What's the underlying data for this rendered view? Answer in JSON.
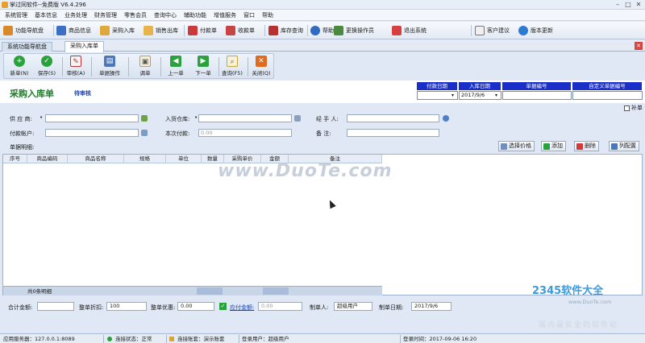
{
  "window": {
    "title": "掌过同软件--免费版 V6.4.296"
  },
  "menu": [
    "系统管理",
    "基本信息",
    "业务处理",
    "财务管理",
    "零售会员",
    "查询中心",
    "辅助功能",
    "增值服务",
    "窗口",
    "帮助"
  ],
  "nav": {
    "items": [
      "功能导航盘",
      "商品信息",
      "采购入库",
      "销售出库",
      "付款单",
      "收款单",
      "库存查询",
      "帮助",
      "更换操作员",
      "退出系统",
      "客户建议",
      "版本更新"
    ]
  },
  "tabs": [
    "系统功能导航盘",
    "采购入库单"
  ],
  "toolbar": {
    "new": "新单(N)",
    "save": "保存(S)",
    "audit": "审核(A)",
    "doc_ops": "单据操作",
    "template": "调单",
    "prev": "上一单",
    "next": "下一单",
    "query": "查询(F5)",
    "close": "关闭(Q)"
  },
  "document": {
    "title": "采购入库单",
    "status": "待审核"
  },
  "header_grid": {
    "columns": [
      "付款日期",
      "入库日期",
      "单据编号",
      "自定义单据编号"
    ],
    "values": [
      "",
      "2017/9/6",
      "",
      ""
    ],
    "supplement_label": "补单"
  },
  "form": {
    "supplier_label": "供 应 商:",
    "warehouse_label": "入货仓库:",
    "handler_label": "经 手 人:",
    "pay_account_label": "付款帐户:",
    "this_payment_label": "本次付款:",
    "this_payment_value": "0.00",
    "remark_label": "备    注:",
    "detail_label": "单据明细:"
  },
  "detail_buttons": {
    "select_price": "选择价格",
    "add": "添加",
    "delete": "删除",
    "columns": "列配置"
  },
  "grid": {
    "columns": [
      "序号",
      "商品编码",
      "商品名称",
      "规格",
      "单位",
      "数量",
      "采购单价",
      "金额",
      "备注"
    ],
    "rows": [],
    "row_count": "共0条明细"
  },
  "watermark": "www.DuoTe.com",
  "totals": {
    "total_label": "合计金额:",
    "total_value": "",
    "discount_label": "整单折扣:",
    "discount_value": "100",
    "offer_label": "整单优惠:",
    "offer_value": "0.00",
    "payable_label": "应付金额:",
    "payable_value": "0.00",
    "maker_label": "制单人:",
    "maker_value": "超级用户",
    "date_label": "制单日期:",
    "date_value": "2017/9/6"
  },
  "status": {
    "server": "应用服务器：127.0.0.1:8089",
    "conn": "连接状态：正常",
    "account": "连接账套：演示账套",
    "user": "登录用户：超级用户",
    "login_time": "登录时间：2017-09-06 16:20"
  },
  "brand": {
    "logo": "2345软件大全",
    "site": "www.DuoTe.com",
    "cn": "国内最安全的软件站"
  },
  "colors": {
    "grid_header": "#1a2fc7",
    "doc_title": "#1e7a2a",
    "status": "#1a44b0"
  }
}
